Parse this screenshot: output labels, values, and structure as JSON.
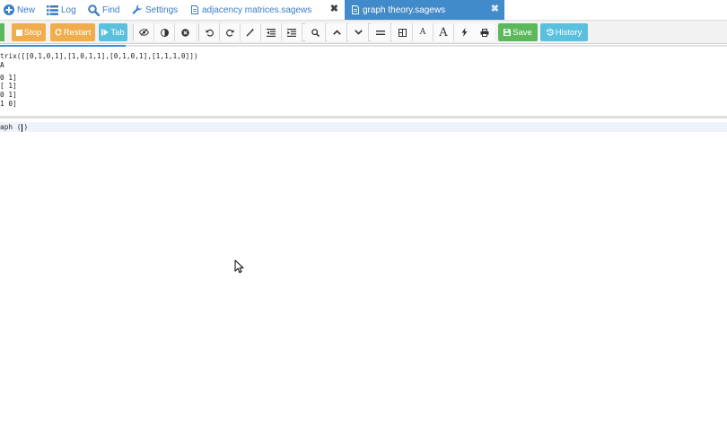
{
  "nav": {
    "new_label": "New",
    "log_label": "Log",
    "find_label": "Find",
    "settings_label": "Settings"
  },
  "tabs": [
    {
      "name": "adjacency matrices.sagews",
      "active": false
    },
    {
      "name": "graph theory.sagews",
      "active": true
    }
  ],
  "toolbar": {
    "stop_label": "Stop",
    "restart_label": "Restart",
    "tab_label": "Tab",
    "save_label": "Save",
    "history_label": "History"
  },
  "editor": {
    "lines": [
      "trix([[0,1,0,1],[1,0,1,1],[0,1,0,1],[1,1,1,0]])",
      "A",
      "0 1]",
      "[ 1]",
      "0 1]",
      "1 0]"
    ],
    "current_line_before_cursor": "aph (",
    "current_line_after_cursor": ")"
  },
  "colors": {
    "accent_blue": "#428bca",
    "green": "#5cb85c",
    "orange": "#f0ad4e",
    "teal": "#5bc0de"
  }
}
